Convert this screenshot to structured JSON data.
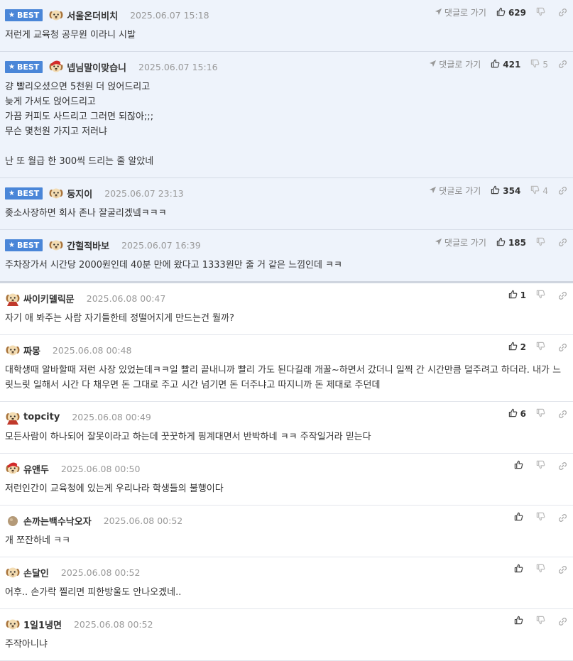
{
  "labels": {
    "best_badge": "BEST",
    "reply_link": "댓글로 가기"
  },
  "colors": {
    "best_bg": "#eef3fb",
    "badge_bg": "#4a86d8"
  },
  "best_comments": [
    {
      "nick": "서울온더비치",
      "date": "2025.06.07 15:18",
      "up": "629",
      "down": "",
      "avatar": "puppy-avatar",
      "text": "저런게 교육청 공무원 이라니 시발"
    },
    {
      "nick": "넵님말이맞습니",
      "date": "2025.06.07 15:16",
      "up": "421",
      "down": "5",
      "avatar": "santa-puppy-avatar",
      "text": "걍 빨리오셨으면 5천원 더 얹어드리고\n늦게 가셔도 얹어드리고\n가끔 커피도 사드리고 그러면 되잖아;;;\n무슨 몇천원 가지고 저러냐\n\n난 또 월급 한 300씩 드리는 줄 알았네"
    },
    {
      "nick": "둥지이",
      "date": "2025.06.07 23:13",
      "up": "354",
      "down": "4",
      "avatar": "puppy-avatar",
      "text": "좆소사장하면 회사 존나 잘굴리겠넼ㅋㅋㅋ"
    },
    {
      "nick": "간헐적바보",
      "date": "2025.06.07 16:39",
      "up": "185",
      "down": "",
      "avatar": "puppy-avatar",
      "text": "주차장가서 시간당 2000원인데 40분 만에 왔다고 1333원만 줄 거 같은 느낌인데 ㅋㅋ"
    }
  ],
  "comments": [
    {
      "nick": "싸이키델릭문",
      "date": "2025.06.08 00:47",
      "up": "1",
      "avatar": "hero-puppy-avatar",
      "text": "자기 애 봐주는 사람 자기들한테 정떨어지게 만드는건 뭘까?"
    },
    {
      "nick": "짜몽",
      "date": "2025.06.08 00:48",
      "up": "2",
      "avatar": "puppy-avatar",
      "text": "대학생때 알바할때 저런 사장 있었는데ㅋㅋ일 빨리 끝내니까 빨리 가도 된다길래 개꿀~하면서 갔더니 일찍 간 시간만큼 덜주려고 하더라. 내가 느릿느릿 일해서 시간 다 채우면 돈 그대로 주고 시간 넘기면 돈 더주냐고 따지니까 돈 제대로 주던데"
    },
    {
      "nick": "topcity",
      "date": "2025.06.08 00:49",
      "up": "6",
      "avatar": "hero-puppy-avatar",
      "text": "모든사람이 하나되어 잘못이라고 하는데 꿋꿋하게 핑계대면서 반박하네 ㅋㅋ 주작일거라 믿는다"
    },
    {
      "nick": "유앤두",
      "date": "2025.06.08 00:50",
      "up": "",
      "avatar": "santa-puppy-avatar",
      "text": "저런인간이 교육청에 있는게 우리나라 학생들의 불행이다"
    },
    {
      "nick": "손까는백수낙오자",
      "date": "2025.06.08 00:52",
      "up": "",
      "avatar": "ball-avatar",
      "text": "개 쪼잔하네 ㅋㅋ"
    },
    {
      "nick": "손달인",
      "date": "2025.06.08 00:52",
      "up": "",
      "avatar": "puppy-avatar",
      "text": "어후.. 손가락 찔리면 피한방울도 안나오겠네.."
    },
    {
      "nick": "1일1냉면",
      "date": "2025.06.08 00:52",
      "up": "",
      "avatar": "puppy-avatar",
      "text": "주작아니냐"
    }
  ]
}
